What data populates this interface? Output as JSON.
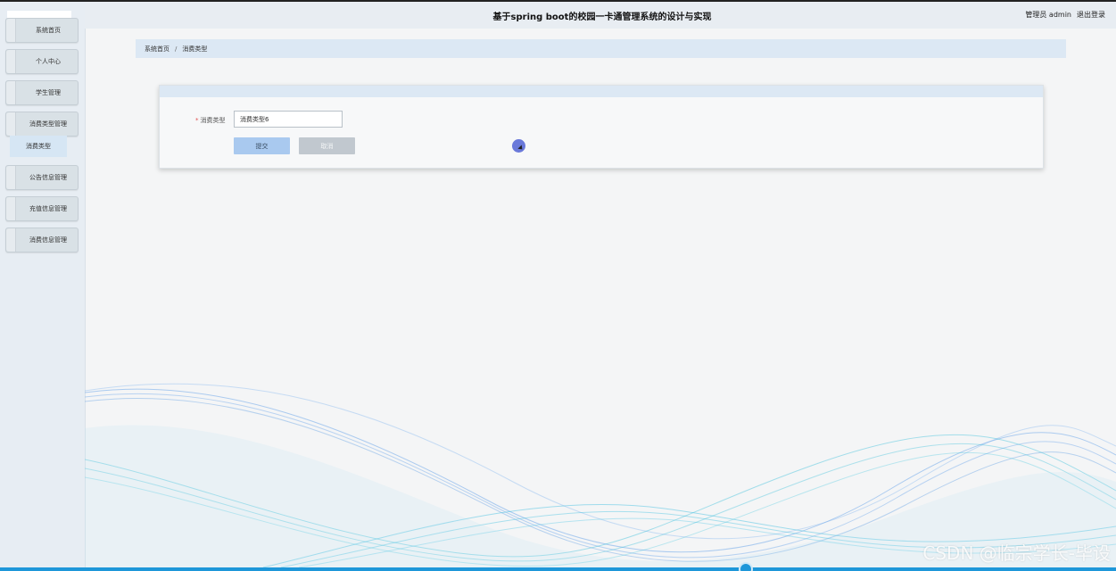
{
  "header": {
    "title": "基于spring boot的校园一卡通管理系统的设计与实现",
    "user_label": "管理员 admin",
    "logout_label": "退出登录"
  },
  "sidebar": {
    "items": [
      {
        "label": "系统首页"
      },
      {
        "label": "个人中心"
      },
      {
        "label": "学生管理"
      },
      {
        "label": "消费类型管理"
      },
      {
        "label": "公告信息管理"
      },
      {
        "label": "充值信息管理"
      },
      {
        "label": "消费信息管理"
      }
    ],
    "submenu": {
      "label": "消费类型"
    }
  },
  "breadcrumb": {
    "home": "系统首页",
    "separator": "/",
    "current": "消费类型"
  },
  "form": {
    "field_label": "消费类型",
    "required_mark": "*",
    "field_value": "消费类型6",
    "submit_label": "提交",
    "cancel_label": "取消"
  },
  "watermark": "CSDN @临宗学长-毕设",
  "colors": {
    "accent": "#1e97d9",
    "breadcrumb_bg": "#dce8f4",
    "submit_bg": "#a9c9ef",
    "cancel_bg": "#c1c8cf"
  }
}
